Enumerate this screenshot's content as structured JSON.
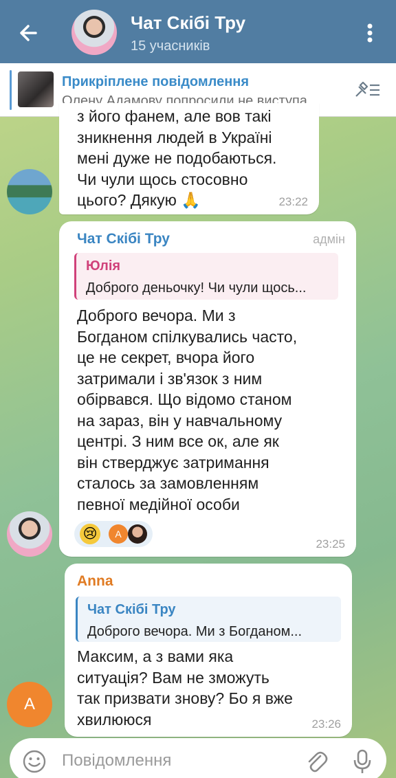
{
  "header": {
    "title": "Чат Скібі Тру",
    "subtitle": "15 учасників"
  },
  "pinned": {
    "title": "Прикріплене повідомлення",
    "text": "Олену Адамову попросили не виступа..."
  },
  "messages": [
    {
      "lines": [
        "з його фанем, але вов такі",
        "зникнення людей в Україні",
        "мені дуже не подобаються.",
        "Чи чули щось стосовно",
        "цього? Дякую 🙏"
      ],
      "time": "23:22"
    },
    {
      "sender": "Чат Скібі Тру",
      "badge": "адмін",
      "reply": {
        "name": "Юлія",
        "text": "Доброго деньочку! Чи чули щось..."
      },
      "lines": [
        "Доброго вечора. Ми з",
        "Богданом спілкувались часто,",
        "це не секрет, вчора його",
        "затримали і зв'язок з ним",
        "обірвався. Що відомо станом",
        "на зараз, він у навчальному",
        "центрі. З ним все ок, але як",
        "він стверджує затримання",
        "сталось за замовленням",
        "певної медійної особи"
      ],
      "reaction_emoji": "😢",
      "reaction_avatar_letter": "А",
      "time": "23:25"
    },
    {
      "sender": "Anna",
      "reply": {
        "name": "Чат Скібі Тру",
        "text": "Доброго вечора. Ми з Богданом..."
      },
      "lines": [
        "Максим, а з вами яка",
        "ситуація? Вам не зможуть",
        "так призвати знову? Бо я вже",
        "хвилююся"
      ],
      "time": "23:26",
      "avatar_letter": "А"
    }
  ],
  "composer": {
    "placeholder": "Повідомлення"
  },
  "colors": {
    "header": "#517da2",
    "link_blue": "#3a8bc8",
    "admin_name": "#3a85c2",
    "yulia": "#d0417a",
    "anna": "#e07b23"
  }
}
